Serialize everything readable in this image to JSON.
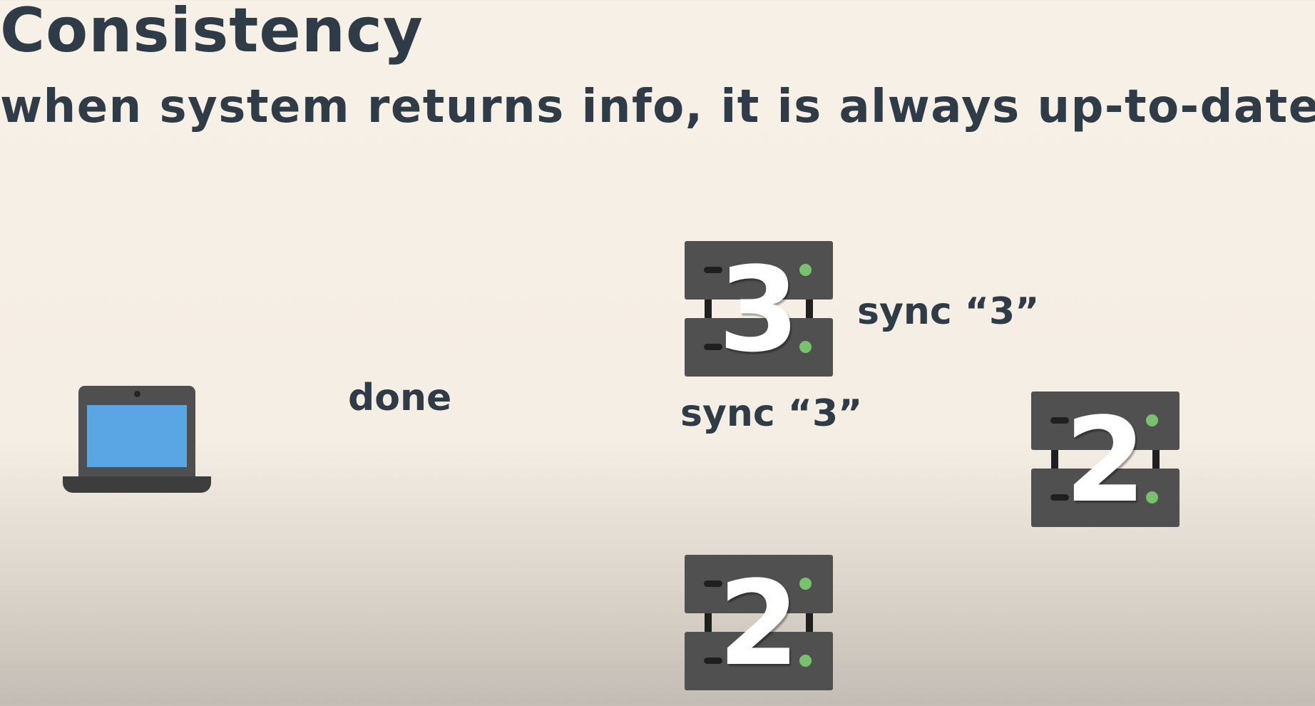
{
  "slide": {
    "title": "Consistency",
    "subtitle": "when system returns info, it is always up-to-date"
  },
  "labels": {
    "done": "done",
    "sync_right": "sync “3”",
    "sync_below": "sync “3”"
  },
  "servers": {
    "top": {
      "value": "3"
    },
    "right": {
      "value": "2"
    },
    "bottom": {
      "value": "2"
    }
  },
  "colors": {
    "text": "#2f3b47",
    "server_body": "#505050",
    "server_led": "#78c26d",
    "laptop_screen": "#5aa6e4",
    "laptop_body": "#4f4f4f"
  },
  "icons": {
    "client": "laptop-icon",
    "server": "server-icon"
  }
}
